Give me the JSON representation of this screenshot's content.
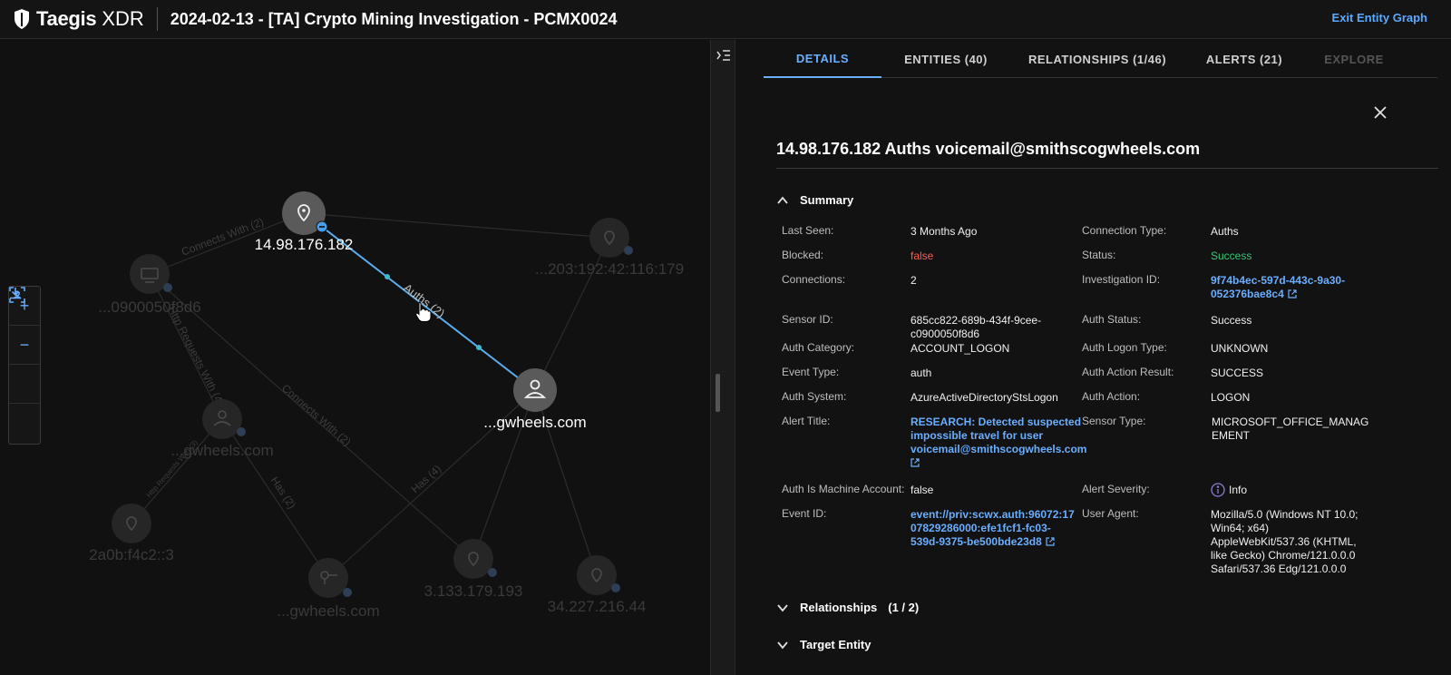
{
  "header": {
    "logo_text": "Taegis",
    "logo_sub": "XDR",
    "title": "2024-02-13 - [TA] Crypto Mining Investigation - PCMX0024",
    "exit_label": "Exit Entity Graph"
  },
  "graph": {
    "nodes": {
      "ip_main": "14.98.176.182",
      "user_main": "...gwheels.com",
      "host": "...0900050f8d6",
      "ip_a": "...203:192:42:116:179",
      "user_b": "...gwheels.com",
      "ip_b": "2a0b:f4c2::3",
      "key": "...gwheels.com",
      "ip_c": "3.133.179.193",
      "ip_d": "34.227.216.44"
    },
    "edges": {
      "auths": "Auths (2)",
      "connects1": "Connects With (2)",
      "http1": "Http Requests With (4)",
      "connects2": "Connects With (2)",
      "http2": "Http Requests With (3)",
      "has1": "Has (2)",
      "has2": "Has (4)"
    },
    "zoom": {
      "in": "+",
      "out": "−"
    }
  },
  "tabs": [
    {
      "label": "DETAILS"
    },
    {
      "label": "ENTITIES  (40)"
    },
    {
      "label": "RELATIONSHIPS  (1/46)"
    },
    {
      "label": "ALERTS  (21)"
    },
    {
      "label": "EXPLORE"
    }
  ],
  "details": {
    "title": "14.98.176.182 Auths voicemail@smithscogwheels.com",
    "summary_label": "Summary",
    "fields": {
      "last_seen_label": "Last Seen:",
      "last_seen": "3 Months Ago",
      "conn_type_label": "Connection Type:",
      "conn_type": "Auths",
      "blocked_label": "Blocked:",
      "blocked": "false",
      "status_label": "Status:",
      "status": "Success",
      "connections_label": "Connections:",
      "connections": "2",
      "inv_id_label": "Investigation ID:",
      "inv_id_1": "9f74b4ec-597d-443c-9a30-",
      "inv_id_2": "052376bae8c4",
      "sensor_id_label": "Sensor ID:",
      "sensor_id_1": "685cc822-689b-434f-9cee-",
      "sensor_id_2": "c0900050f8d6",
      "auth_status_label": "Auth Status:",
      "auth_status": "Success",
      "auth_category_label": "Auth Category:",
      "auth_category": "ACCOUNT_LOGON",
      "auth_logon_type_label": "Auth Logon Type:",
      "auth_logon_type": "UNKNOWN",
      "event_type_label": "Event Type:",
      "event_type": "auth",
      "auth_action_result_label": "Auth Action Result:",
      "auth_action_result": "SUCCESS",
      "auth_system_label": "Auth System:",
      "auth_system": "AzureActiveDirectoryStsLogon",
      "auth_action_label": "Auth Action:",
      "auth_action": "LOGON",
      "alert_title_label": "Alert Title:",
      "alert_title_1": "RESEARCH: Detected suspected",
      "alert_title_2": "impossible travel for user",
      "alert_title_3": "voicemail@smithscogwheels.com",
      "sensor_type_label": "Sensor Type:",
      "sensor_type_1": "MICROSOFT_OFFICE_MANAG",
      "sensor_type_2": "EMENT",
      "machine_label": "Auth Is Machine Account:",
      "machine": "false",
      "severity_label": "Alert Severity:",
      "severity": "Info",
      "event_id_label": "Event ID:",
      "event_id_1": "event://priv:scwx.auth:96072:17",
      "event_id_2": "07829286000:efe1fcf1-fc03-",
      "event_id_3": "539d-9375-be500bde23d8",
      "user_agent_label": "User Agent:",
      "user_agent_1": "Mozilla/5.0 (Windows NT 10.0;",
      "user_agent_2": "Win64; x64)",
      "user_agent_3": "AppleWebKit/537.36 (KHTML,",
      "user_agent_4": "like Gecko) Chrome/121.0.0.0",
      "user_agent_5": "Safari/537.36 Edg/121.0.0.0"
    },
    "relationships_label": "Relationships",
    "relationships_count": "(1 / 2)",
    "target_label": "Target Entity"
  },
  "colors": {
    "accent": "#6aaeff",
    "danger": "#ff5a4f",
    "success": "#38c776"
  }
}
